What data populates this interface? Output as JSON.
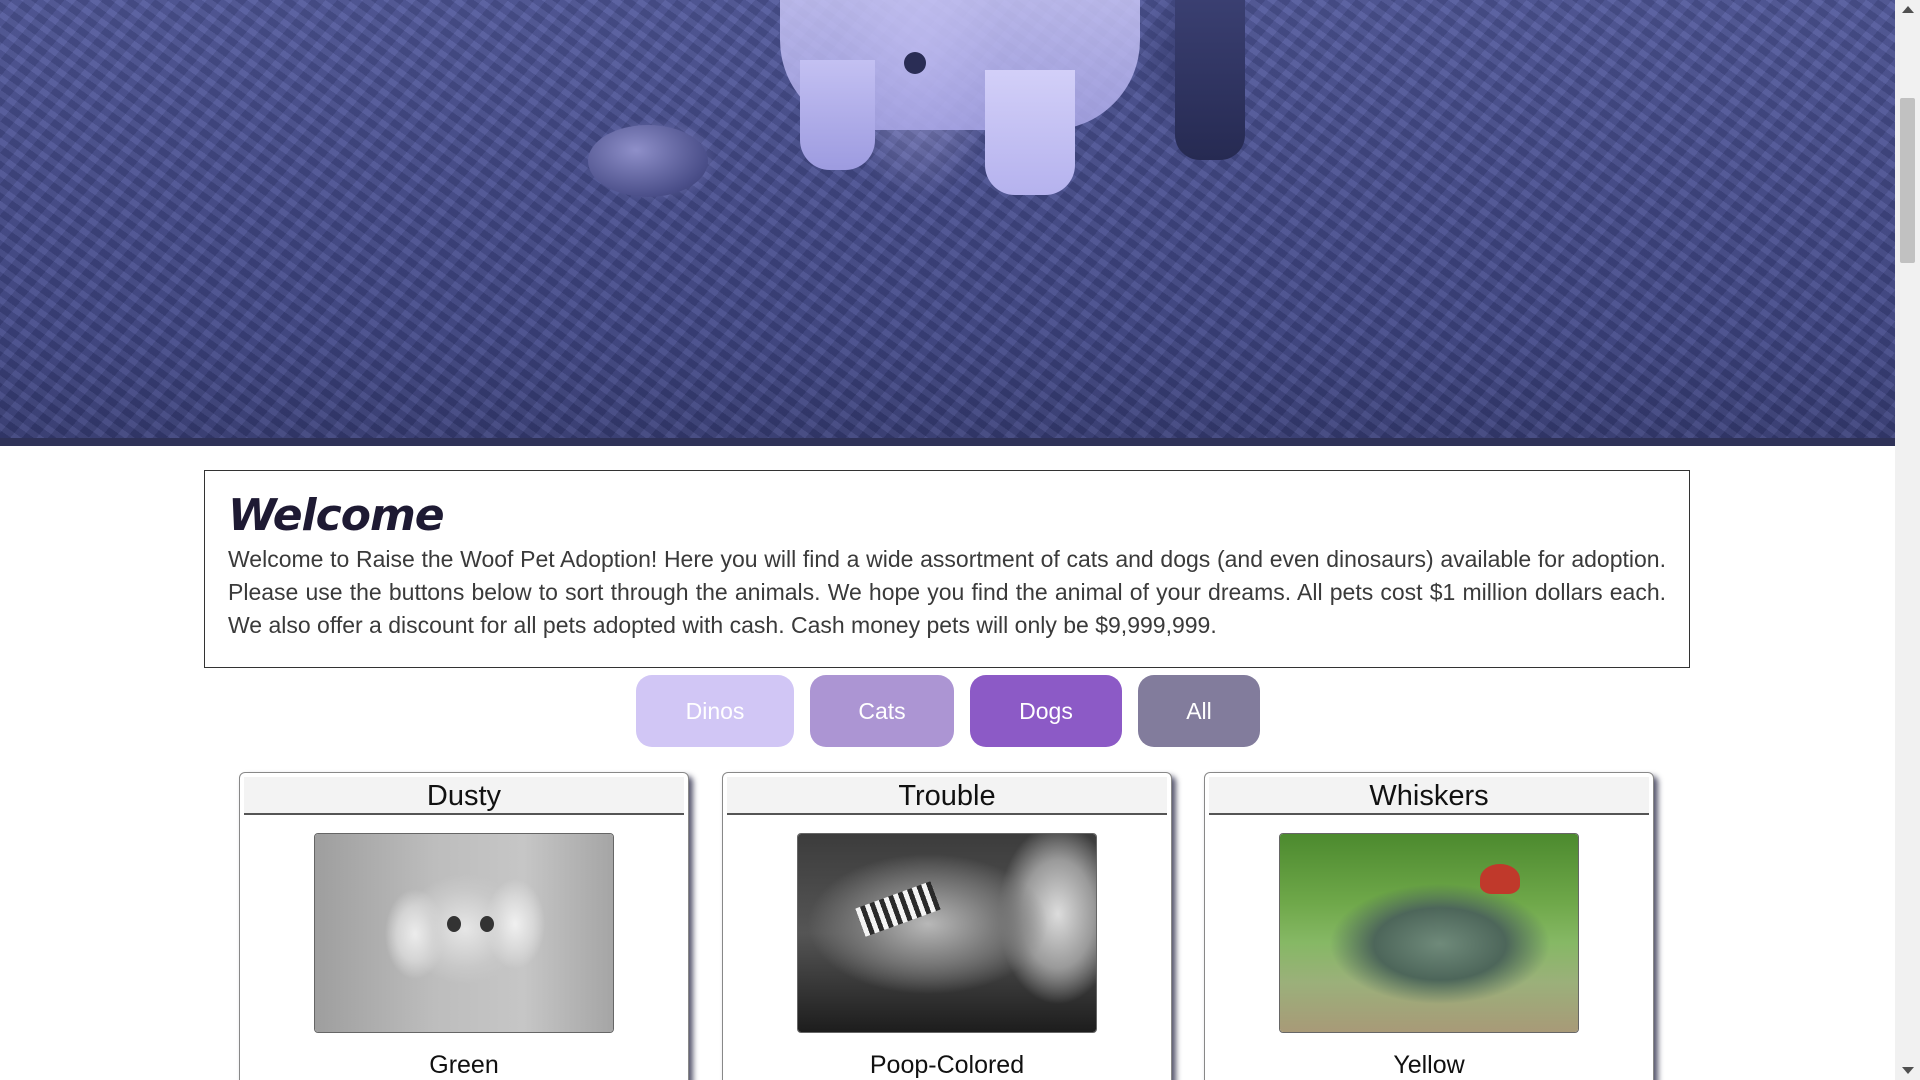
{
  "welcome": {
    "heading": "Welcome",
    "body": "Welcome to Raise the Woof Pet Adoption! Here you will find a wide assortment of cats and dogs (and even dinosaurs) available for adoption. Please use the buttons below to sort through the animals. We hope you find the animal of your dreams. All pets cost $1 million dollars each. We also offer a discount for all pets adopted with cash. Cash money pets will only be $9,999,999."
  },
  "filters": {
    "dinos": "Dinos",
    "cats": "Cats",
    "dogs": "Dogs",
    "all": "All"
  },
  "colors": {
    "dinos_button": "#d1c6f5",
    "cats_button": "#ac95d3",
    "dogs_button": "#8c5ac6",
    "all_button": "#827c9c"
  },
  "pets": [
    {
      "name": "Dusty",
      "color": "Green"
    },
    {
      "name": "Trouble",
      "color": "Poop-Colored"
    },
    {
      "name": "Whiskers",
      "color": "Yellow"
    }
  ]
}
